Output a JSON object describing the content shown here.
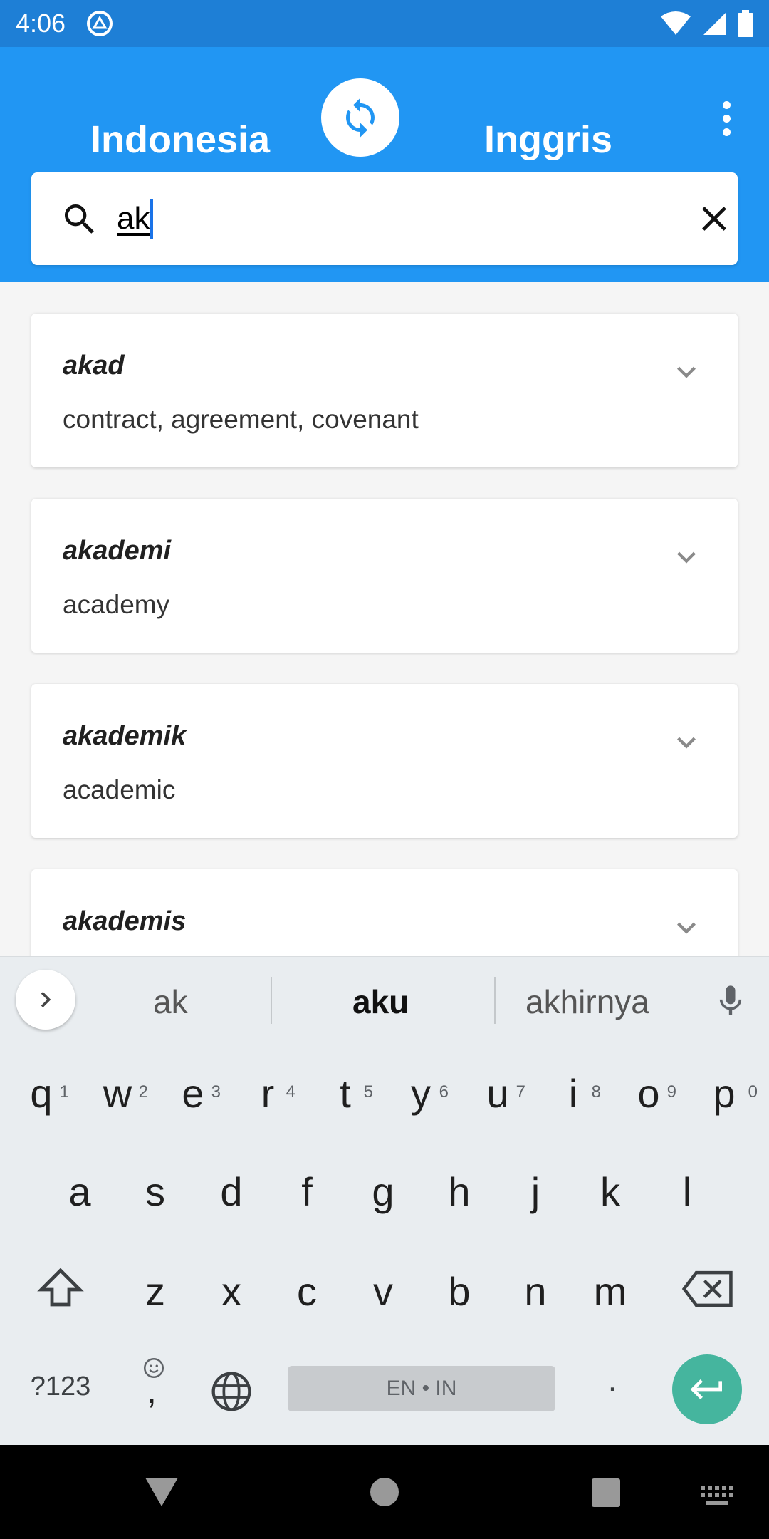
{
  "status_bar": {
    "time": "4:06"
  },
  "header": {
    "source_language": "Indonesia",
    "target_language": "Inggris",
    "accent_color": "#2196f3"
  },
  "search": {
    "value": "ak"
  },
  "results": [
    {
      "word": "akad",
      "meaning": "contract, agreement, covenant"
    },
    {
      "word": "akademi",
      "meaning": "academy"
    },
    {
      "word": "akademik",
      "meaning": "academic"
    },
    {
      "word": "akademis",
      "meaning": ""
    }
  ],
  "keyboard": {
    "suggestions": [
      "ak",
      "aku",
      "akhirnya"
    ],
    "row1": [
      "q",
      "w",
      "e",
      "r",
      "t",
      "y",
      "u",
      "i",
      "o",
      "p"
    ],
    "row1_hints": [
      "1",
      "2",
      "3",
      "4",
      "5",
      "6",
      "7",
      "8",
      "9",
      "0"
    ],
    "row2": [
      "a",
      "s",
      "d",
      "f",
      "g",
      "h",
      "j",
      "k",
      "l"
    ],
    "row3": [
      "z",
      "x",
      "c",
      "v",
      "b",
      "n",
      "m"
    ],
    "symbols_label": "?123",
    "comma": ",",
    "period": ".",
    "space_label": "EN • IN",
    "enter_color": "#45b59e"
  }
}
